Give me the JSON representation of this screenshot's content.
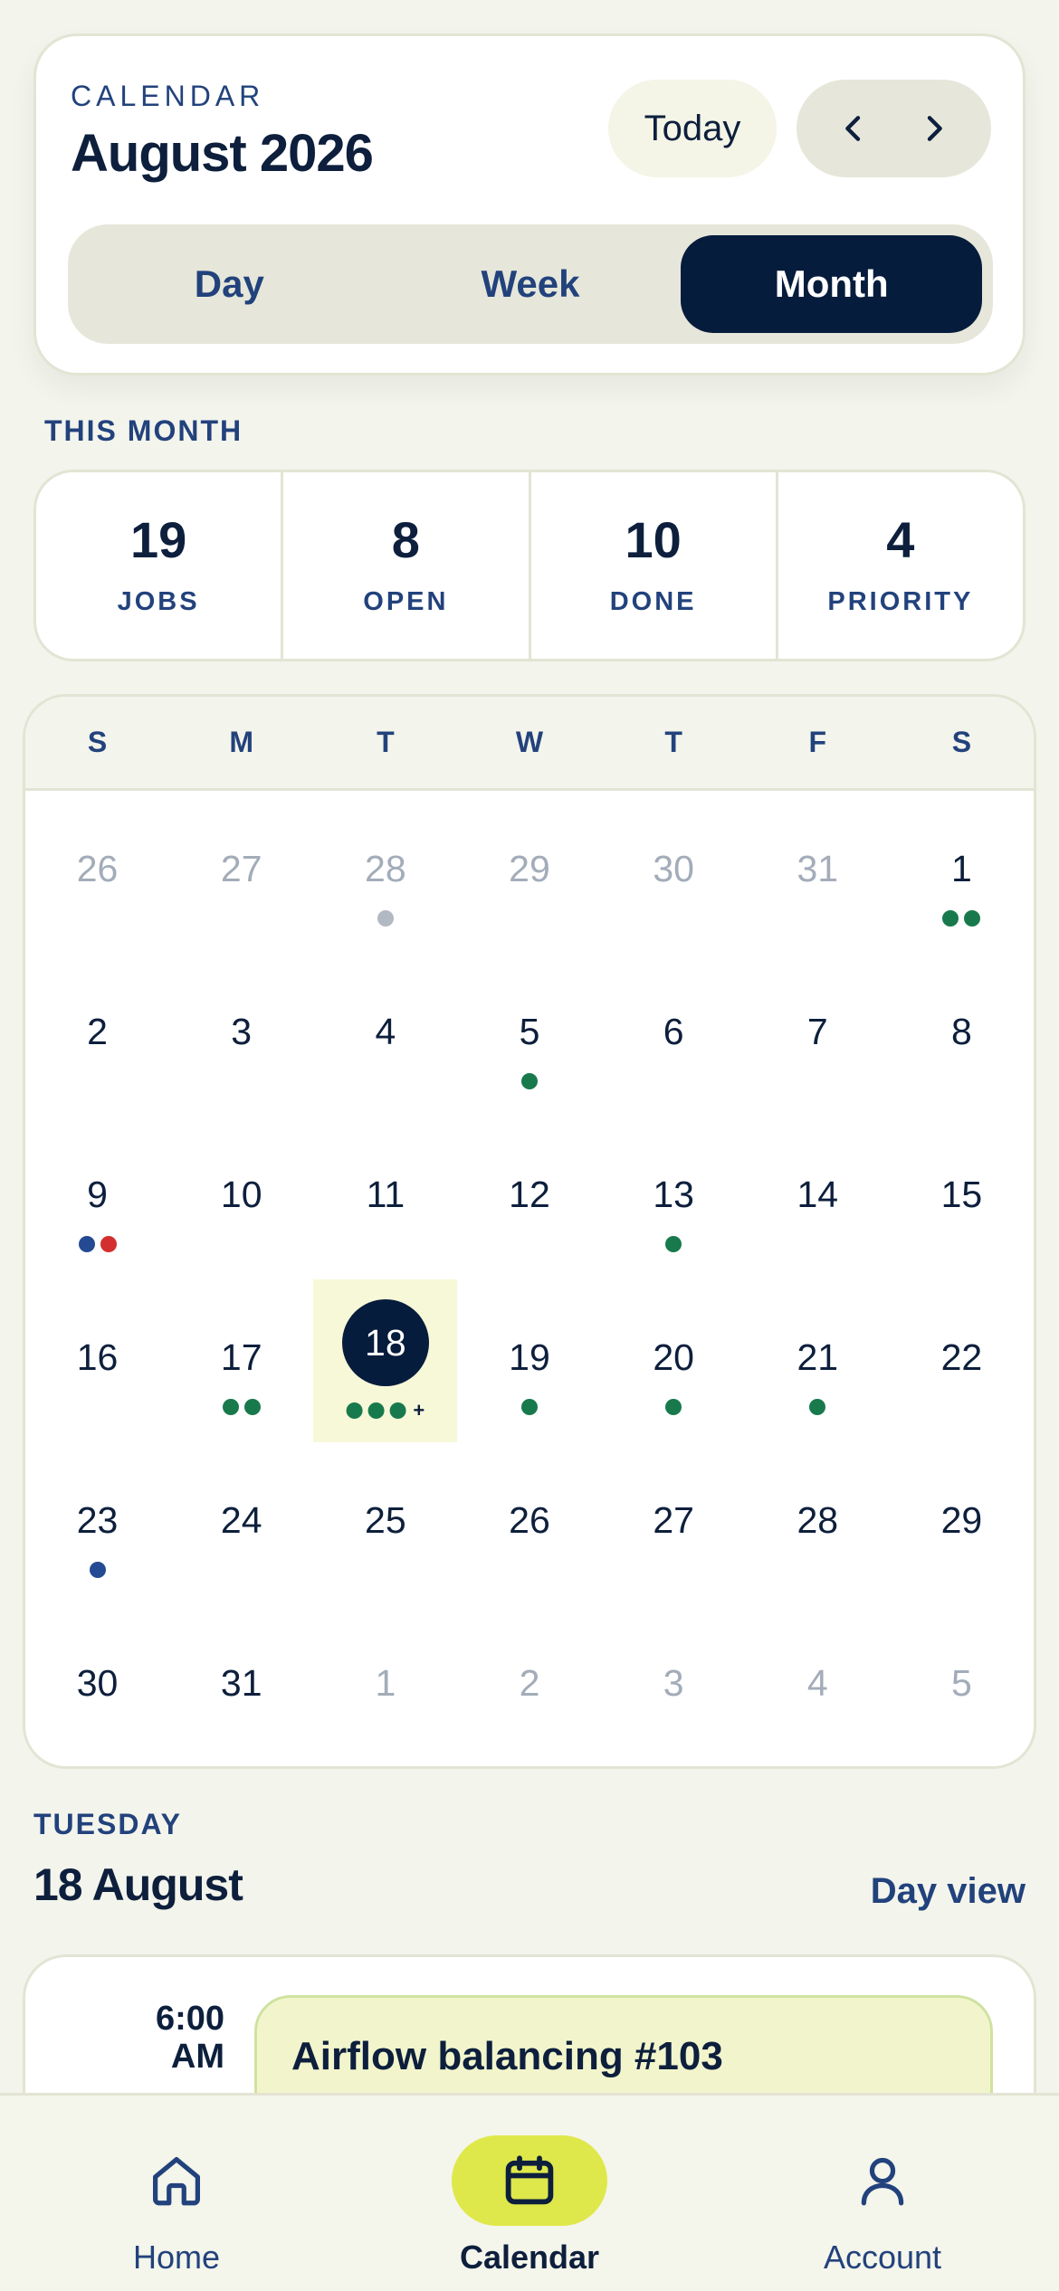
{
  "header": {
    "eyebrow": "CALENDAR",
    "title": "August 2026",
    "today_label": "Today",
    "prev_icon": "chevron-left-icon",
    "next_icon": "chevron-right-icon",
    "views": [
      {
        "label": "Day",
        "active": false
      },
      {
        "label": "Week",
        "active": false
      },
      {
        "label": "Month",
        "active": true
      }
    ]
  },
  "stats": {
    "section_label": "THIS MONTH",
    "items": [
      {
        "value": "19",
        "label": "JOBS"
      },
      {
        "value": "8",
        "label": "OPEN"
      },
      {
        "value": "10",
        "label": "DONE"
      },
      {
        "value": "4",
        "label": "PRIORITY"
      }
    ]
  },
  "calendar": {
    "weekdays": [
      "S",
      "M",
      "T",
      "W",
      "T",
      "F",
      "S"
    ],
    "weeks": [
      [
        {
          "n": "26",
          "other": true
        },
        {
          "n": "27",
          "other": true
        },
        {
          "n": "28",
          "other": true,
          "dots": [
            "grey"
          ]
        },
        {
          "n": "29",
          "other": true
        },
        {
          "n": "30",
          "other": true
        },
        {
          "n": "31",
          "other": true
        },
        {
          "n": "1",
          "dots": [
            "green",
            "green"
          ]
        }
      ],
      [
        {
          "n": "2"
        },
        {
          "n": "3"
        },
        {
          "n": "4"
        },
        {
          "n": "5",
          "dots": [
            "green"
          ]
        },
        {
          "n": "6"
        },
        {
          "n": "7"
        },
        {
          "n": "8"
        }
      ],
      [
        {
          "n": "9",
          "dots": [
            "blue",
            "red"
          ]
        },
        {
          "n": "10"
        },
        {
          "n": "11"
        },
        {
          "n": "12"
        },
        {
          "n": "13",
          "dots": [
            "green"
          ]
        },
        {
          "n": "14"
        },
        {
          "n": "15"
        }
      ],
      [
        {
          "n": "16"
        },
        {
          "n": "17",
          "dots": [
            "green",
            "green"
          ]
        },
        {
          "n": "18",
          "selected": true,
          "dots": [
            "green",
            "green",
            "green"
          ],
          "more": "+"
        },
        {
          "n": "19",
          "dots": [
            "green"
          ]
        },
        {
          "n": "20",
          "dots": [
            "green"
          ]
        },
        {
          "n": "21",
          "dots": [
            "green"
          ]
        },
        {
          "n": "22"
        }
      ],
      [
        {
          "n": "23",
          "dots": [
            "blue"
          ]
        },
        {
          "n": "24"
        },
        {
          "n": "25"
        },
        {
          "n": "26"
        },
        {
          "n": "27"
        },
        {
          "n": "28"
        },
        {
          "n": "29"
        }
      ],
      [
        {
          "n": "30"
        },
        {
          "n": "31"
        },
        {
          "n": "1",
          "other": true
        },
        {
          "n": "2",
          "other": true
        },
        {
          "n": "3",
          "other": true
        },
        {
          "n": "4",
          "other": true
        },
        {
          "n": "5",
          "other": true
        }
      ]
    ]
  },
  "day_section": {
    "weekday_label": "TUESDAY",
    "date_label": "18 August",
    "day_view_label": "Day view"
  },
  "agenda": {
    "time_line1": "6:00",
    "time_line2": "AM",
    "event_title": "Airflow balancing #103"
  },
  "tabs": [
    {
      "label": "Home",
      "icon": "home-icon",
      "active": false
    },
    {
      "label": "Calendar",
      "icon": "calendar-icon",
      "active": true
    },
    {
      "label": "Account",
      "icon": "user-icon",
      "active": false
    }
  ],
  "colors": {
    "navy": "#061c3c",
    "accent_blue": "#22427c",
    "lime": "#dfe84a",
    "green_dot": "#187a4c",
    "red_dot": "#d32f2f"
  }
}
